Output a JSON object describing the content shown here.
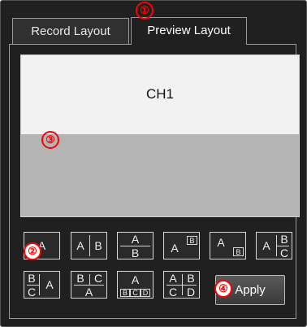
{
  "tabs": {
    "record": "Record Layout",
    "preview": "Preview Layout"
  },
  "preview": {
    "channel": "CH1"
  },
  "badges": [
    "①",
    "②",
    "③",
    "④"
  ],
  "layouts": [
    {
      "cells": [
        "A"
      ]
    },
    {
      "cells": [
        "A",
        "B"
      ]
    },
    {
      "cells": [
        "A",
        "B"
      ]
    },
    {
      "cells": [
        "A",
        "B"
      ]
    },
    {
      "cells": [
        "A",
        "B"
      ]
    },
    {
      "cells": [
        "A",
        "B",
        "C"
      ]
    },
    {
      "cells": [
        "B",
        "C",
        "A"
      ]
    },
    {
      "cells": [
        "B",
        "C",
        "A"
      ]
    },
    {
      "cells": [
        "A",
        "B",
        "C",
        "D"
      ]
    },
    {
      "cells": [
        "A",
        "B",
        "C",
        "D"
      ]
    }
  ],
  "apply_label": "Apply",
  "colors": {
    "annotation": "#ff0000",
    "panel_bg": "#202020"
  }
}
